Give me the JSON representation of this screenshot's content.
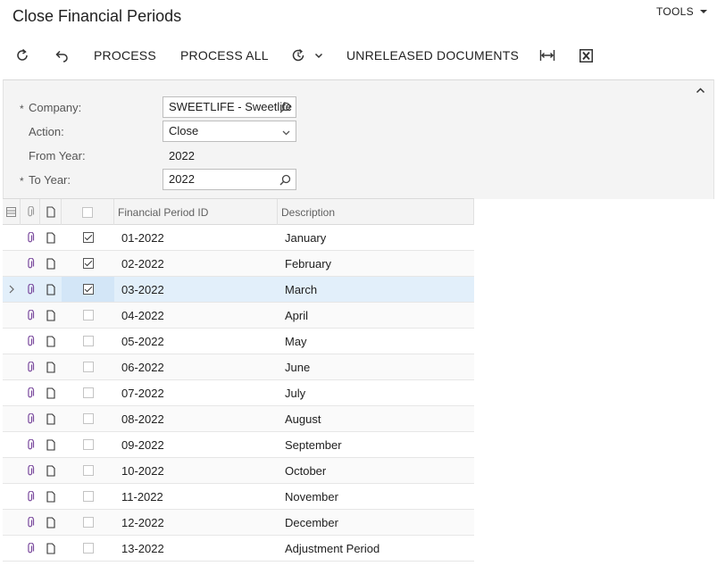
{
  "page": {
    "title": "Close Financial Periods",
    "tools_label": "TOOLS"
  },
  "toolbar": {
    "refresh_icon": "refresh-icon",
    "undo_icon": "undo-icon",
    "process_label": "PROCESS",
    "process_all_label": "PROCESS ALL",
    "schedule_icon": "schedule-icon",
    "unreleased_label": "UNRELEASED DOCUMENTS",
    "fit_icon": "fit-columns-icon",
    "excel_icon": "excel-icon"
  },
  "form": {
    "company_label": "Company:",
    "company_value": "SWEETLIFE - Sweetlife",
    "action_label": "Action:",
    "action_value": "Close",
    "from_year_label": "From Year:",
    "from_year_value": "2022",
    "to_year_label": "To Year:",
    "to_year_value": "2022",
    "required_mark": "*"
  },
  "grid": {
    "columns": {
      "period_id": "Financial Period ID",
      "description": "Description"
    },
    "rows": [
      {
        "id": "01-2022",
        "desc": "January",
        "checked": true
      },
      {
        "id": "02-2022",
        "desc": "February",
        "checked": true
      },
      {
        "id": "03-2022",
        "desc": "March",
        "checked": true,
        "selected": true
      },
      {
        "id": "04-2022",
        "desc": "April",
        "checked": false
      },
      {
        "id": "05-2022",
        "desc": "May",
        "checked": false
      },
      {
        "id": "06-2022",
        "desc": "June",
        "checked": false
      },
      {
        "id": "07-2022",
        "desc": "July",
        "checked": false
      },
      {
        "id": "08-2022",
        "desc": "August",
        "checked": false
      },
      {
        "id": "09-2022",
        "desc": "September",
        "checked": false
      },
      {
        "id": "10-2022",
        "desc": "October",
        "checked": false
      },
      {
        "id": "11-2022",
        "desc": "November",
        "checked": false
      },
      {
        "id": "12-2022",
        "desc": "December",
        "checked": false
      },
      {
        "id": "13-2022",
        "desc": "Adjustment Period",
        "checked": false
      }
    ]
  }
}
